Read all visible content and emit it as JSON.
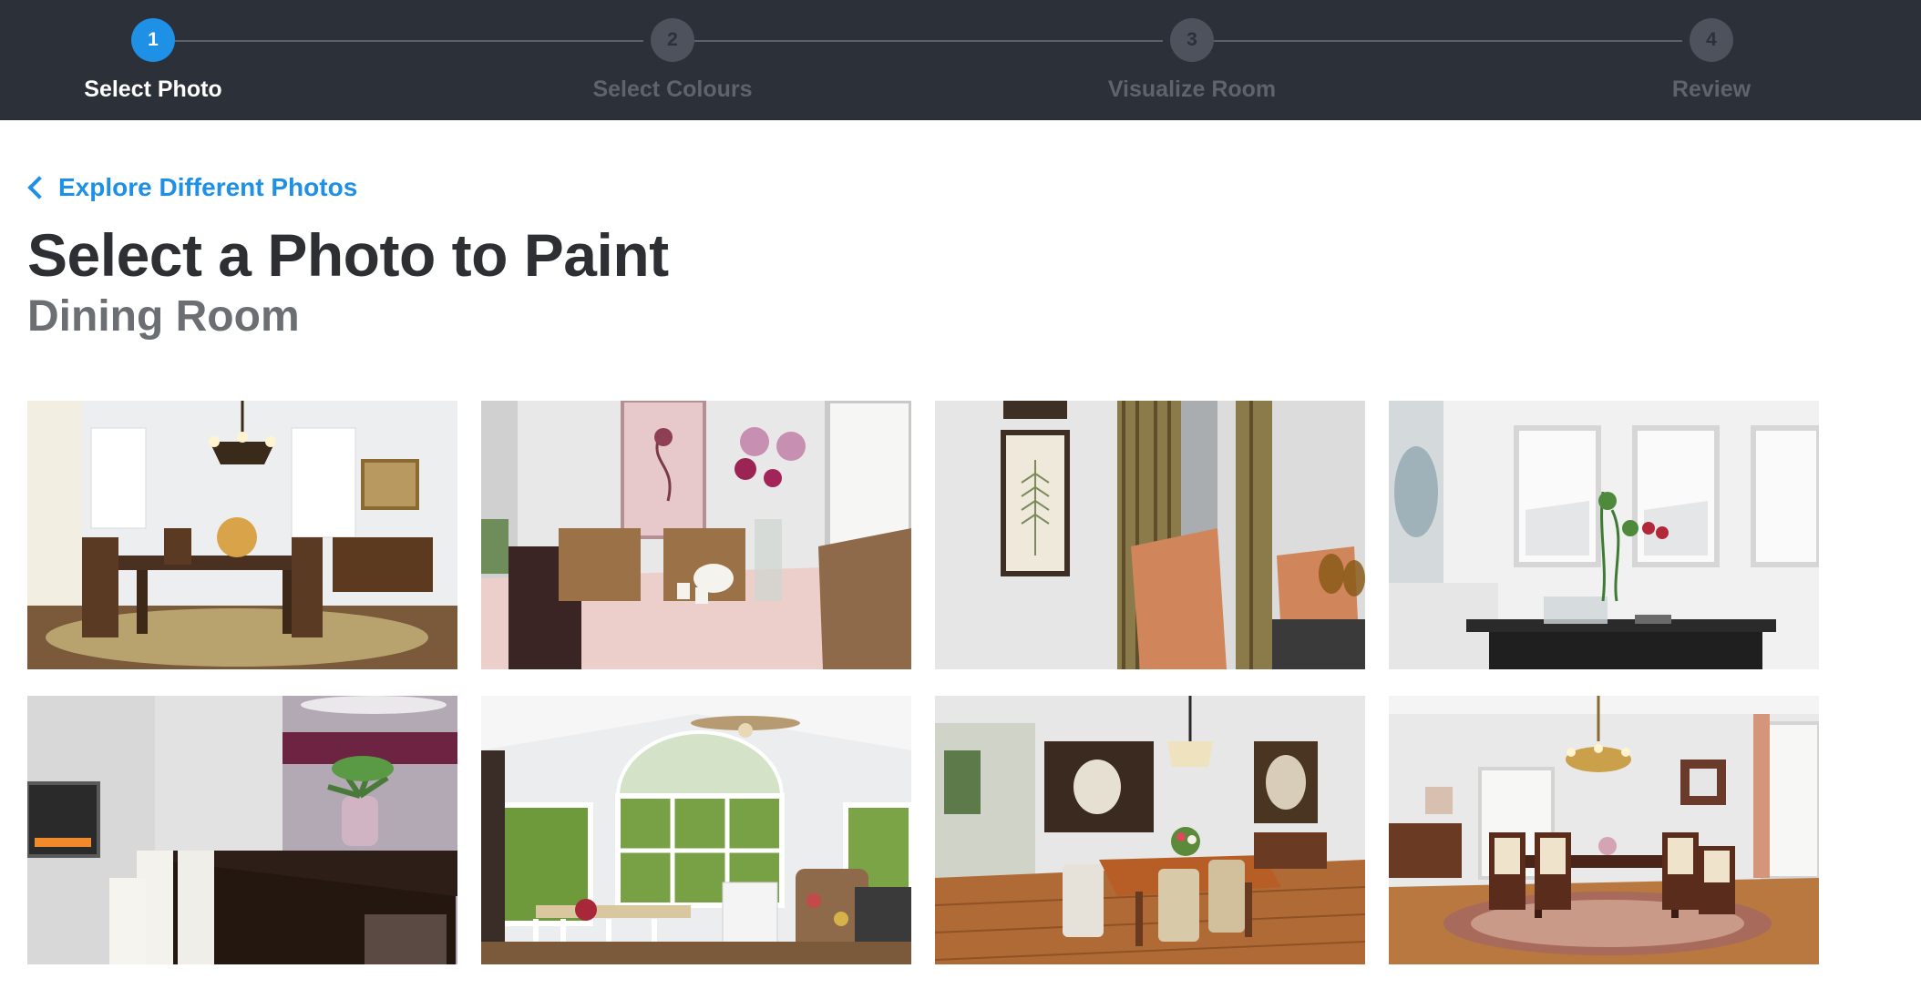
{
  "stepper": {
    "steps": [
      {
        "number": "1",
        "label": "Select Photo",
        "state": "active"
      },
      {
        "number": "2",
        "label": "Select Colours",
        "state": "inactive"
      },
      {
        "number": "3",
        "label": "Visualize Room",
        "state": "inactive"
      },
      {
        "number": "4",
        "label": "Review",
        "state": "inactive"
      }
    ]
  },
  "colors": {
    "header_bg": "#2c3038",
    "active_step": "#1e90e6",
    "inactive_step": "#4d525c",
    "link": "#1e90e6",
    "title": "#2d2f33",
    "subtitle": "#6b6e73"
  },
  "nav": {
    "back_label": "Explore Different Photos",
    "back_icon": "chevron-left-icon"
  },
  "page": {
    "title": "Select a Photo to Paint",
    "subtitle": "Dining Room"
  },
  "photos": [
    {
      "id": "dining-photo-1",
      "description": "dining room with chandelier and wooden table"
    },
    {
      "id": "dining-photo-2",
      "description": "table with pink tablecloth, woven chairs and flowers"
    },
    {
      "id": "dining-photo-3",
      "description": "orange chair, framed fern print and striped curtains"
    },
    {
      "id": "dining-photo-4",
      "description": "white room with windows and glass vase on table"
    },
    {
      "id": "dining-photo-5",
      "description": "fireplace, white chairs and dark table with flowers"
    },
    {
      "id": "dining-photo-6",
      "description": "sunroom with arched window and ceiling fan"
    },
    {
      "id": "dining-photo-7",
      "description": "dining room with hardwood floor and pendant lamp"
    },
    {
      "id": "dining-photo-8",
      "description": "dining room with chandelier, rug and curtains"
    }
  ]
}
